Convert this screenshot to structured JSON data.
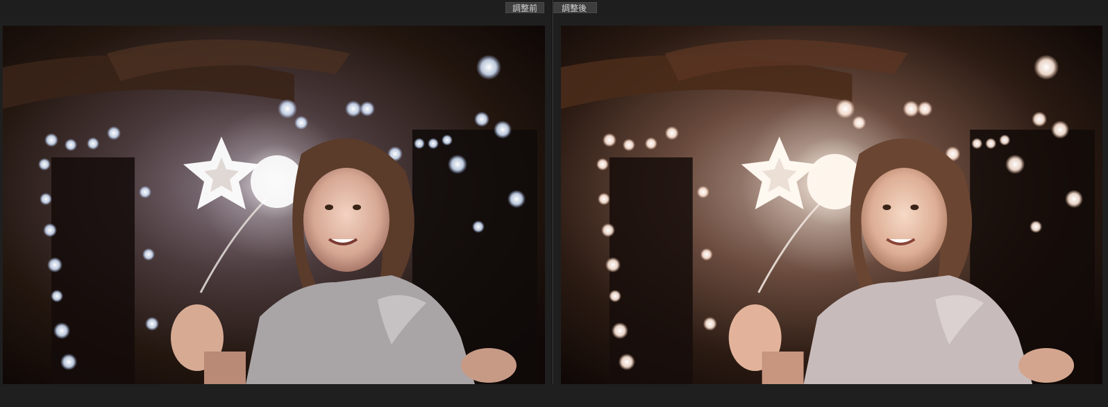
{
  "compare": {
    "before_label": "調整前",
    "after_label": "調整後"
  },
  "photo": {
    "subject": "girl-holding-star-sparkler"
  },
  "colors": {
    "background": "#1f1f1f",
    "tab_background": "#3d3d3d",
    "tab_text": "#d6d6d6"
  }
}
